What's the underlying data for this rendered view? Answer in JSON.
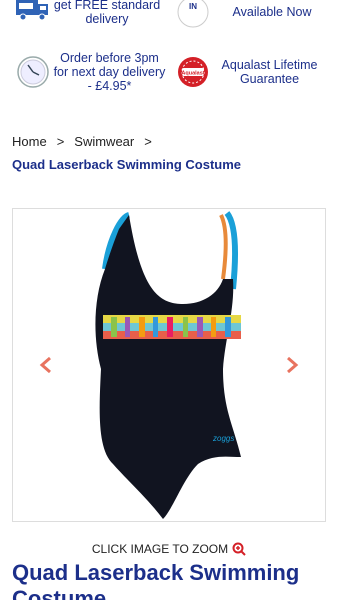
{
  "usps": {
    "delivery": "get FREE standard delivery",
    "new_badge": "NEW IN",
    "new_text": "Available Now",
    "order": "Order before 3pm for next day delivery - £4.95*",
    "guarantee_badge": "Aqualast",
    "guarantee": "Aqualast Lifetime Guarantee"
  },
  "breadcrumb": {
    "home": "Home",
    "sep1": ">",
    "section": "Swimwear",
    "sep2": ">",
    "current": "Quad Laserback Swimming Costume"
  },
  "gallery": {
    "zoom_hint": "CLICK IMAGE TO ZOOM",
    "brand_mark": "zoggs"
  },
  "product": {
    "title": "Quad Laserback Swimming Costume"
  },
  "colors": {
    "brand_blue": "#1c2f8a",
    "arrow_coral": "#e8735f",
    "badge_red": "#d42027"
  }
}
